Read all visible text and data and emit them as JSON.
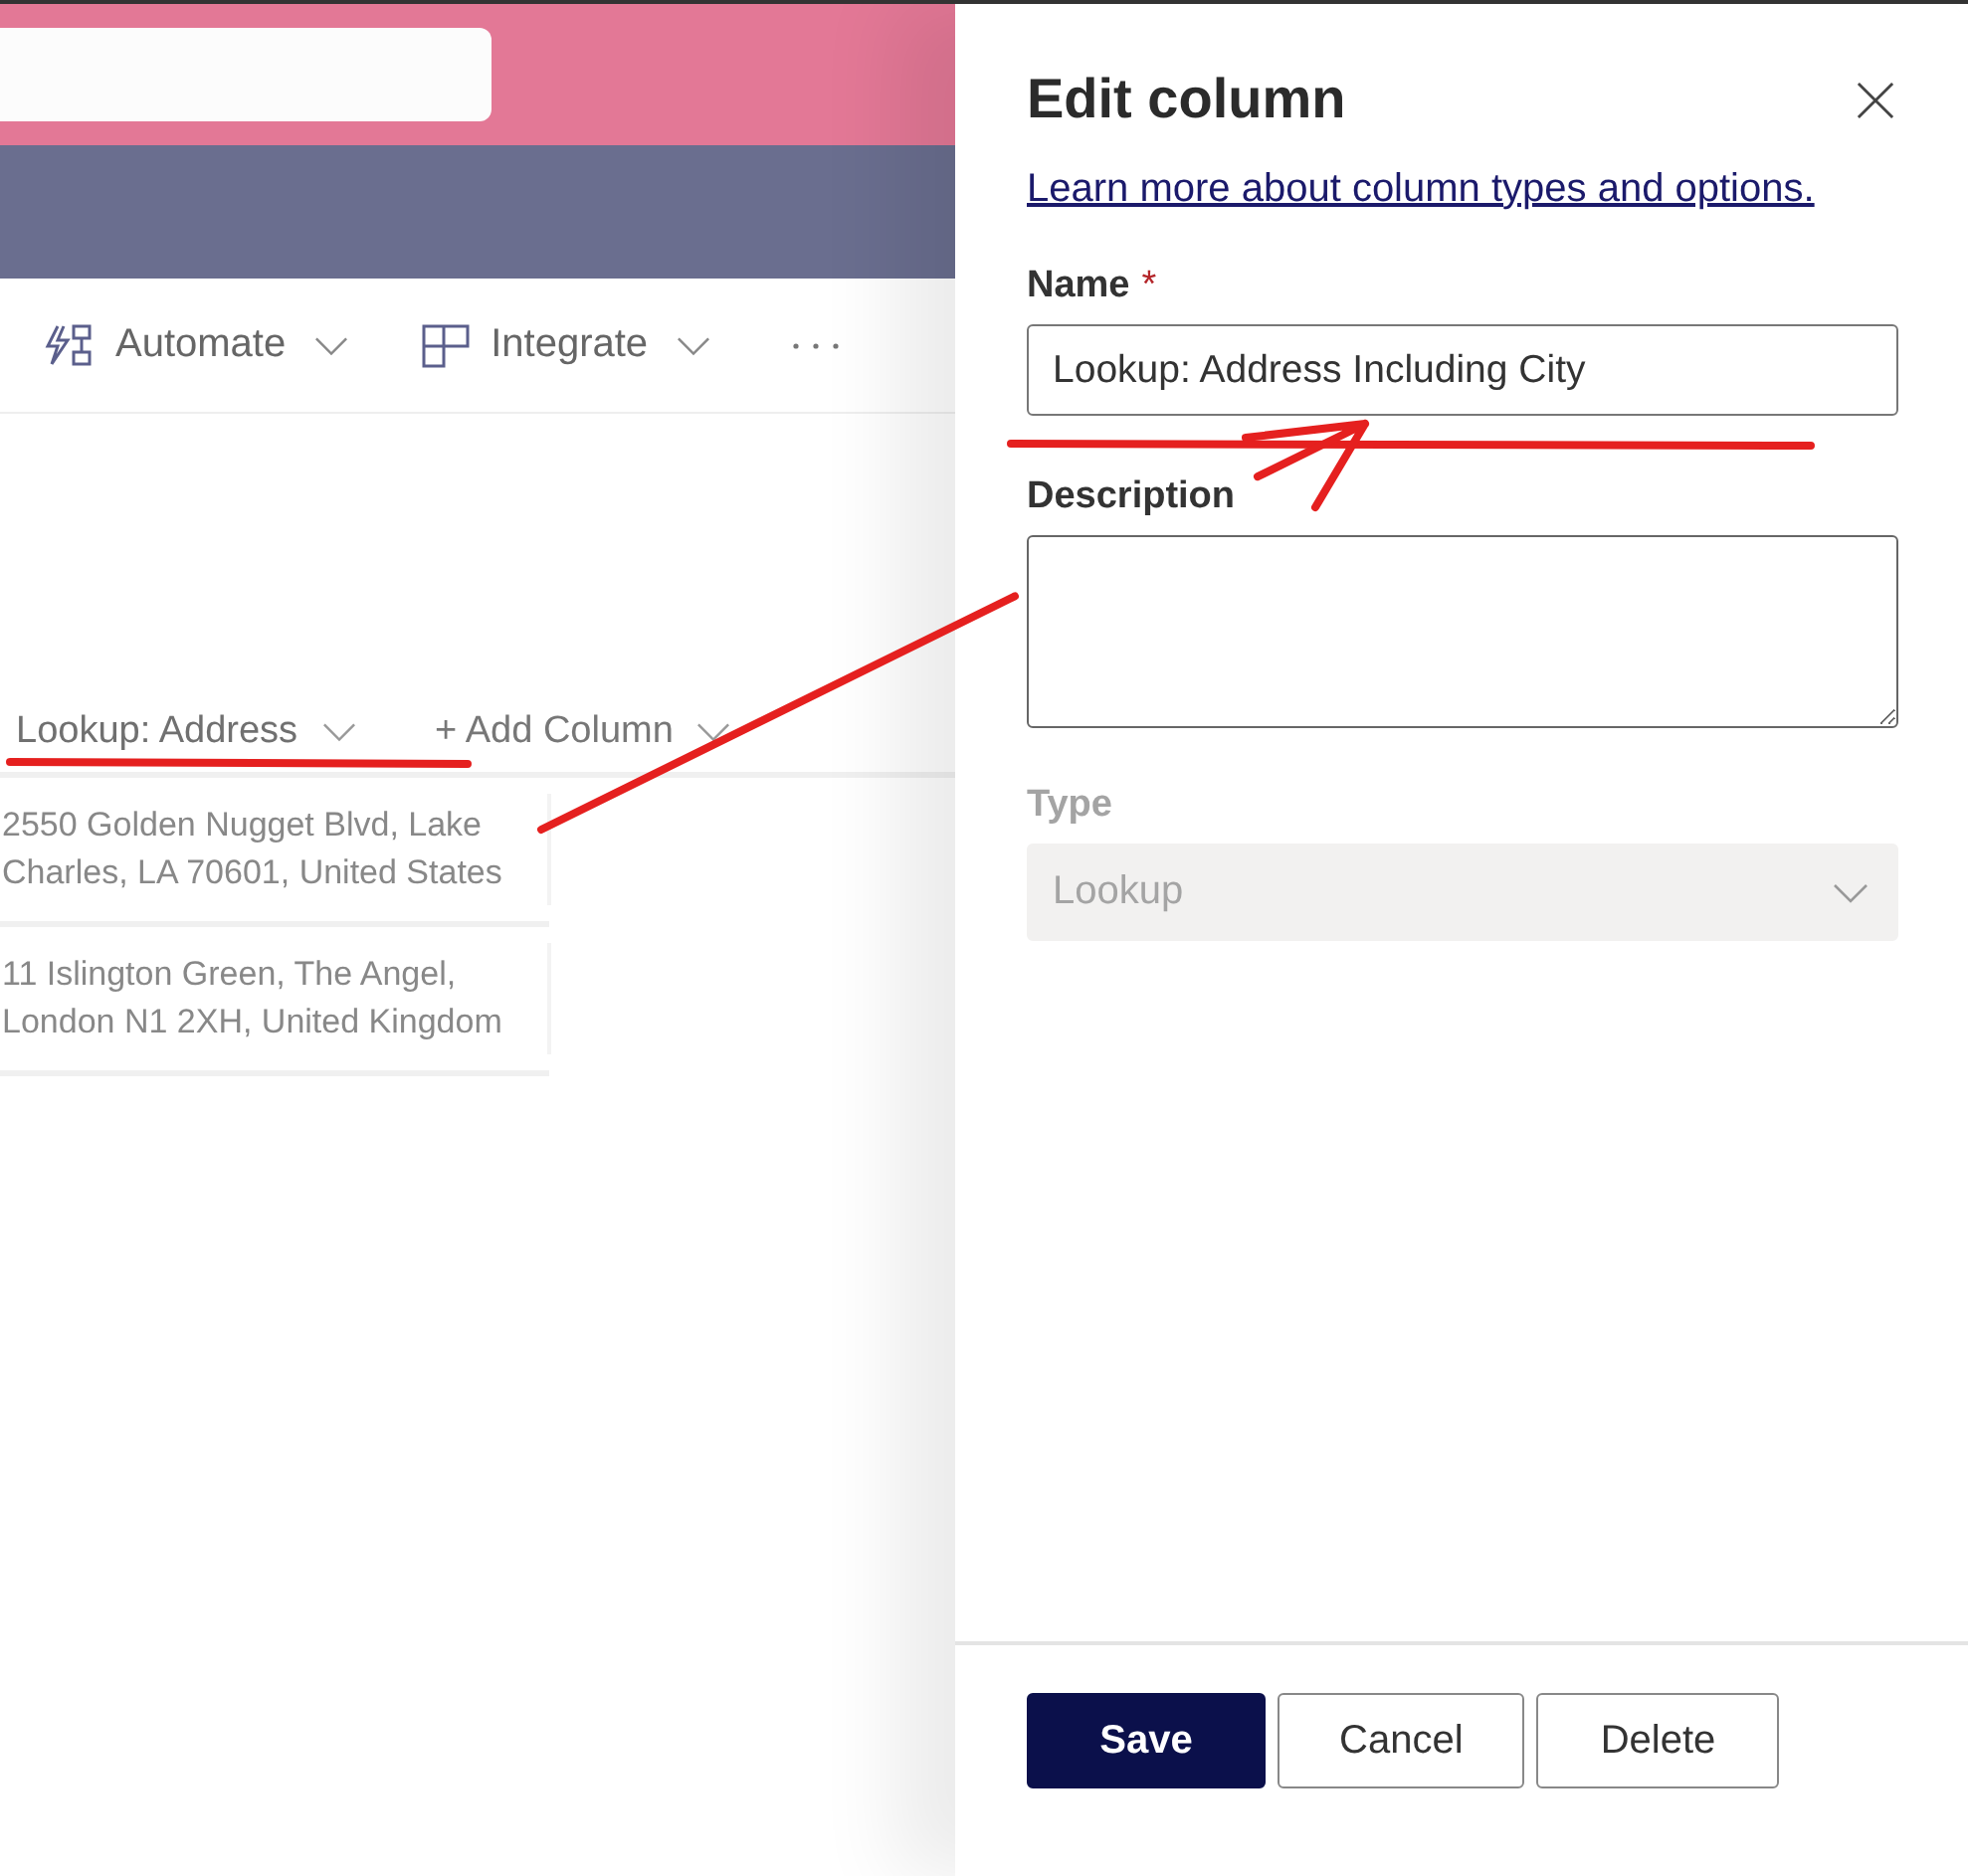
{
  "toolbar": {
    "items": [
      {
        "label": "Automate",
        "kind": "automate"
      },
      {
        "label": "Integrate",
        "kind": "integrate"
      }
    ]
  },
  "list": {
    "columns": [
      {
        "label": "Lookup: Address",
        "kind": "column"
      },
      {
        "label": "+ Add Column",
        "kind": "add"
      }
    ],
    "rows": [
      "2550 Golden Nugget Blvd, Lake Charles, LA 70601, United States",
      "11 Islington Green, The Angel, London N1 2XH, United Kingdom"
    ]
  },
  "panel": {
    "title": "Edit column",
    "link": "Learn more about column types and options.",
    "name": {
      "label": "Name",
      "required_mark": "*",
      "value": "Lookup: Address Including City"
    },
    "description": {
      "label": "Description"
    },
    "type": {
      "label": "Type",
      "value": "Lookup",
      "disabled": true
    },
    "buttons": [
      {
        "label": "Save",
        "primary": true
      },
      {
        "label": "Cancel",
        "primary": false
      },
      {
        "label": "Delete",
        "primary": false
      }
    ]
  }
}
